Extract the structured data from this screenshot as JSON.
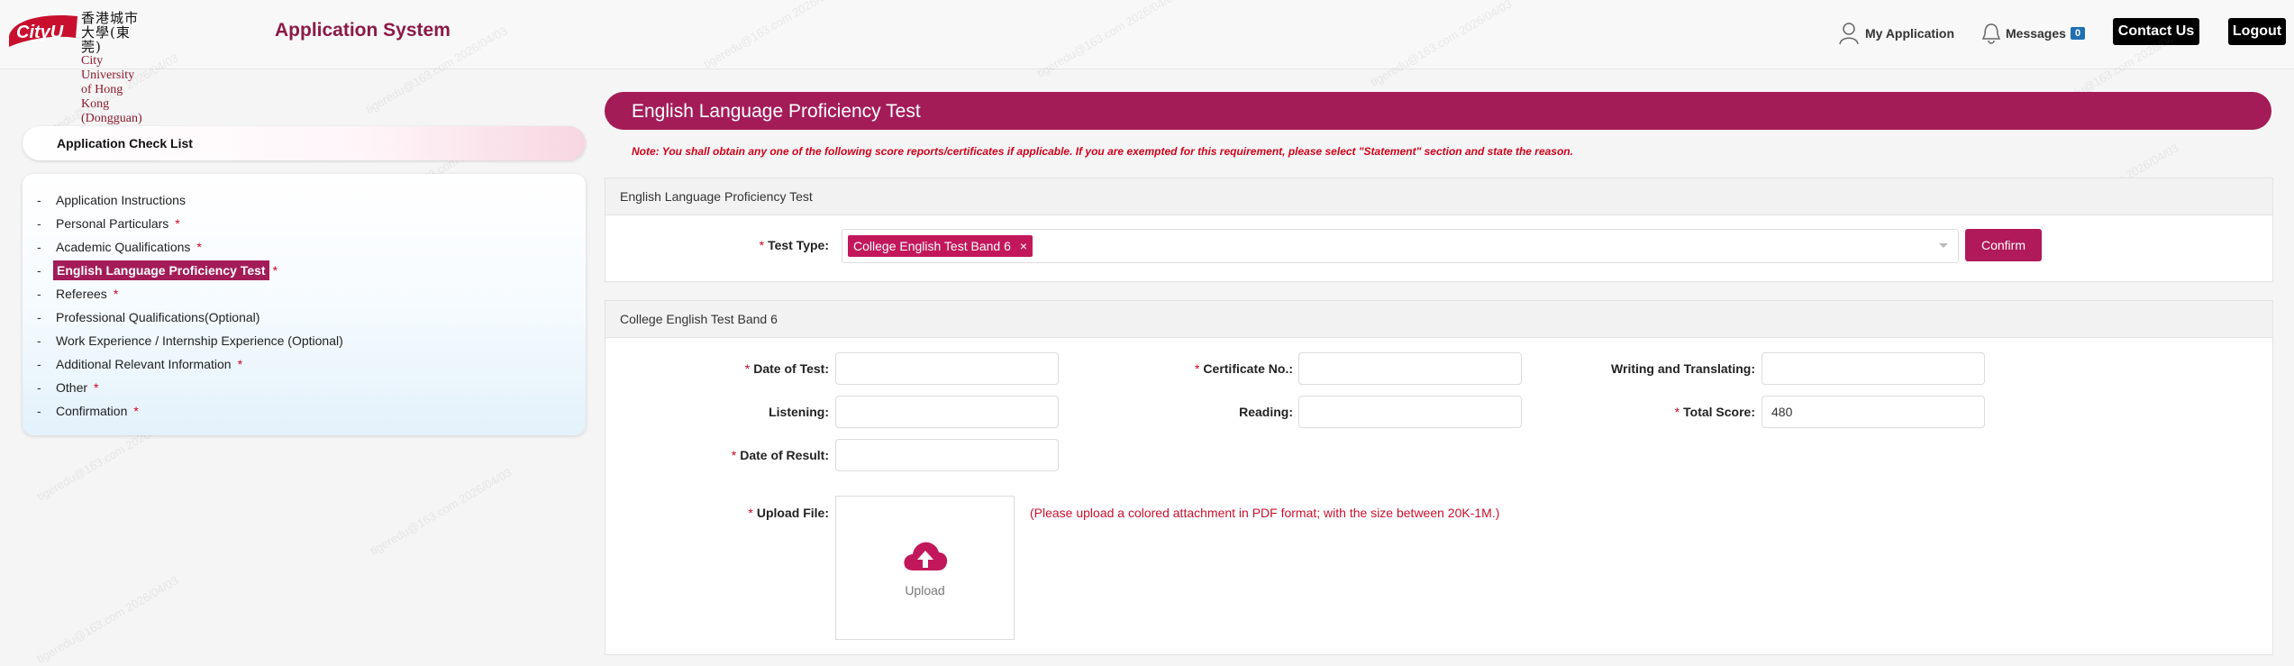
{
  "header": {
    "logo_badge": "CityU",
    "logo_cn": "香港城市大學(東莞)",
    "logo_en_line1": "City University of Hong Kong",
    "logo_en_line2": "(Dongguan)",
    "app_title": "Application System",
    "my_application": "My Application",
    "messages": "Messages",
    "messages_count": "0",
    "contact_us": "Contact Us",
    "logout": "Logout"
  },
  "watermark": "tigeredu@163.com 2026/04/03",
  "checklist": {
    "title": "Application Check List",
    "items": [
      {
        "label": "Application Instructions",
        "required": ""
      },
      {
        "label": "Personal Particulars",
        "required": "*"
      },
      {
        "label": "Academic Qualifications",
        "required": "*"
      },
      {
        "label": "English Language Proficiency Test",
        "required": "*"
      },
      {
        "label": "Referees",
        "required": "*"
      },
      {
        "label": "Professional Qualifications(Optional)",
        "required": ""
      },
      {
        "label": "Work Experience / Internship Experience (Optional)",
        "required": ""
      },
      {
        "label": "Additional Relevant Information",
        "required": "*"
      },
      {
        "label": "Other",
        "required": "*"
      },
      {
        "label": "Confirmation",
        "required": "*"
      }
    ]
  },
  "section": {
    "title": "English Language Proficiency Test",
    "note": "Note:  You shall obtain any one of the following score reports/certificates if applicable. If you are exempted for this requirement, please select  \"Statement\"  section and state the reason."
  },
  "panel1": {
    "title": "English Language Proficiency Test",
    "test_type_label": "Test Type:",
    "selected_tag": "College English Test Band 6",
    "tag_remove": "×",
    "confirm": "Confirm"
  },
  "panel2": {
    "title": "College English Test Band 6",
    "date_of_test_label": "Date of Test:",
    "certificate_no_label": "Certificate No.:",
    "writing_label": "Writing and Translating:",
    "listening_label": "Listening:",
    "reading_label": "Reading:",
    "total_score_label": "Total Score:",
    "total_score_value": "480",
    "date_of_result_label": "Date of Result:",
    "upload_file_label": "Upload File:",
    "upload_text": "Upload",
    "upload_hint": "(Please upload a colored attachment in PDF format; with the size between 20K-1M.)",
    "required_mark": "*"
  },
  "colors": {
    "brand": "#a31c58",
    "required": "#d0021b",
    "badge": "#1f6fb2"
  }
}
